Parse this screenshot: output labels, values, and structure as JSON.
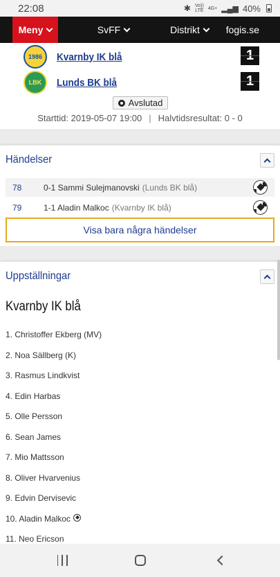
{
  "status_bar": {
    "time": "22:08",
    "volte": "Vo))",
    "lte": "LTE",
    "net": "4G+",
    "battery": "40%"
  },
  "nav": {
    "menu_label": "Meny",
    "svff_label": "SvFF",
    "distrikt_label": "Distrikt",
    "fogis_label": "fogis.se"
  },
  "match": {
    "home_team": "Kvarnby IK blå",
    "away_team": "Lunds BK blå",
    "home_score": "1",
    "away_score": "1",
    "home_logo_text": "1986",
    "status_label": "Avslutad",
    "start_time": "Starttid: 2019-05-07 19:00",
    "halftime": "Halvtidsresultat: 0 - 0"
  },
  "events": {
    "title": "Händelser",
    "items": [
      {
        "minute": "78",
        "text": "0-1 Sammi Sulejmanovski",
        "team": "(Lunds BK blå)"
      },
      {
        "minute": "79",
        "text": "1-1 Aladin Malkoc",
        "team": "(Kvarnby IK blå)"
      }
    ],
    "show_some_label": "Visa bara några händelser"
  },
  "lineups": {
    "title": "Uppställningar",
    "team_heading": "Kvarnby IK blå",
    "players": [
      "1. Christoffer Ekberg (MV)",
      "2. Noa Sällberg (K)",
      "3. Rasmus Lindkvist",
      "4. Edin Harbas",
      "5. Olle Persson",
      "6. Sean James",
      "7. Mio Mattsson",
      "8. Oliver Hvarvenius",
      "9. Edvin Dervisevic",
      "10. Aladin Malkoc",
      "11. Neo Ericson"
    ]
  }
}
